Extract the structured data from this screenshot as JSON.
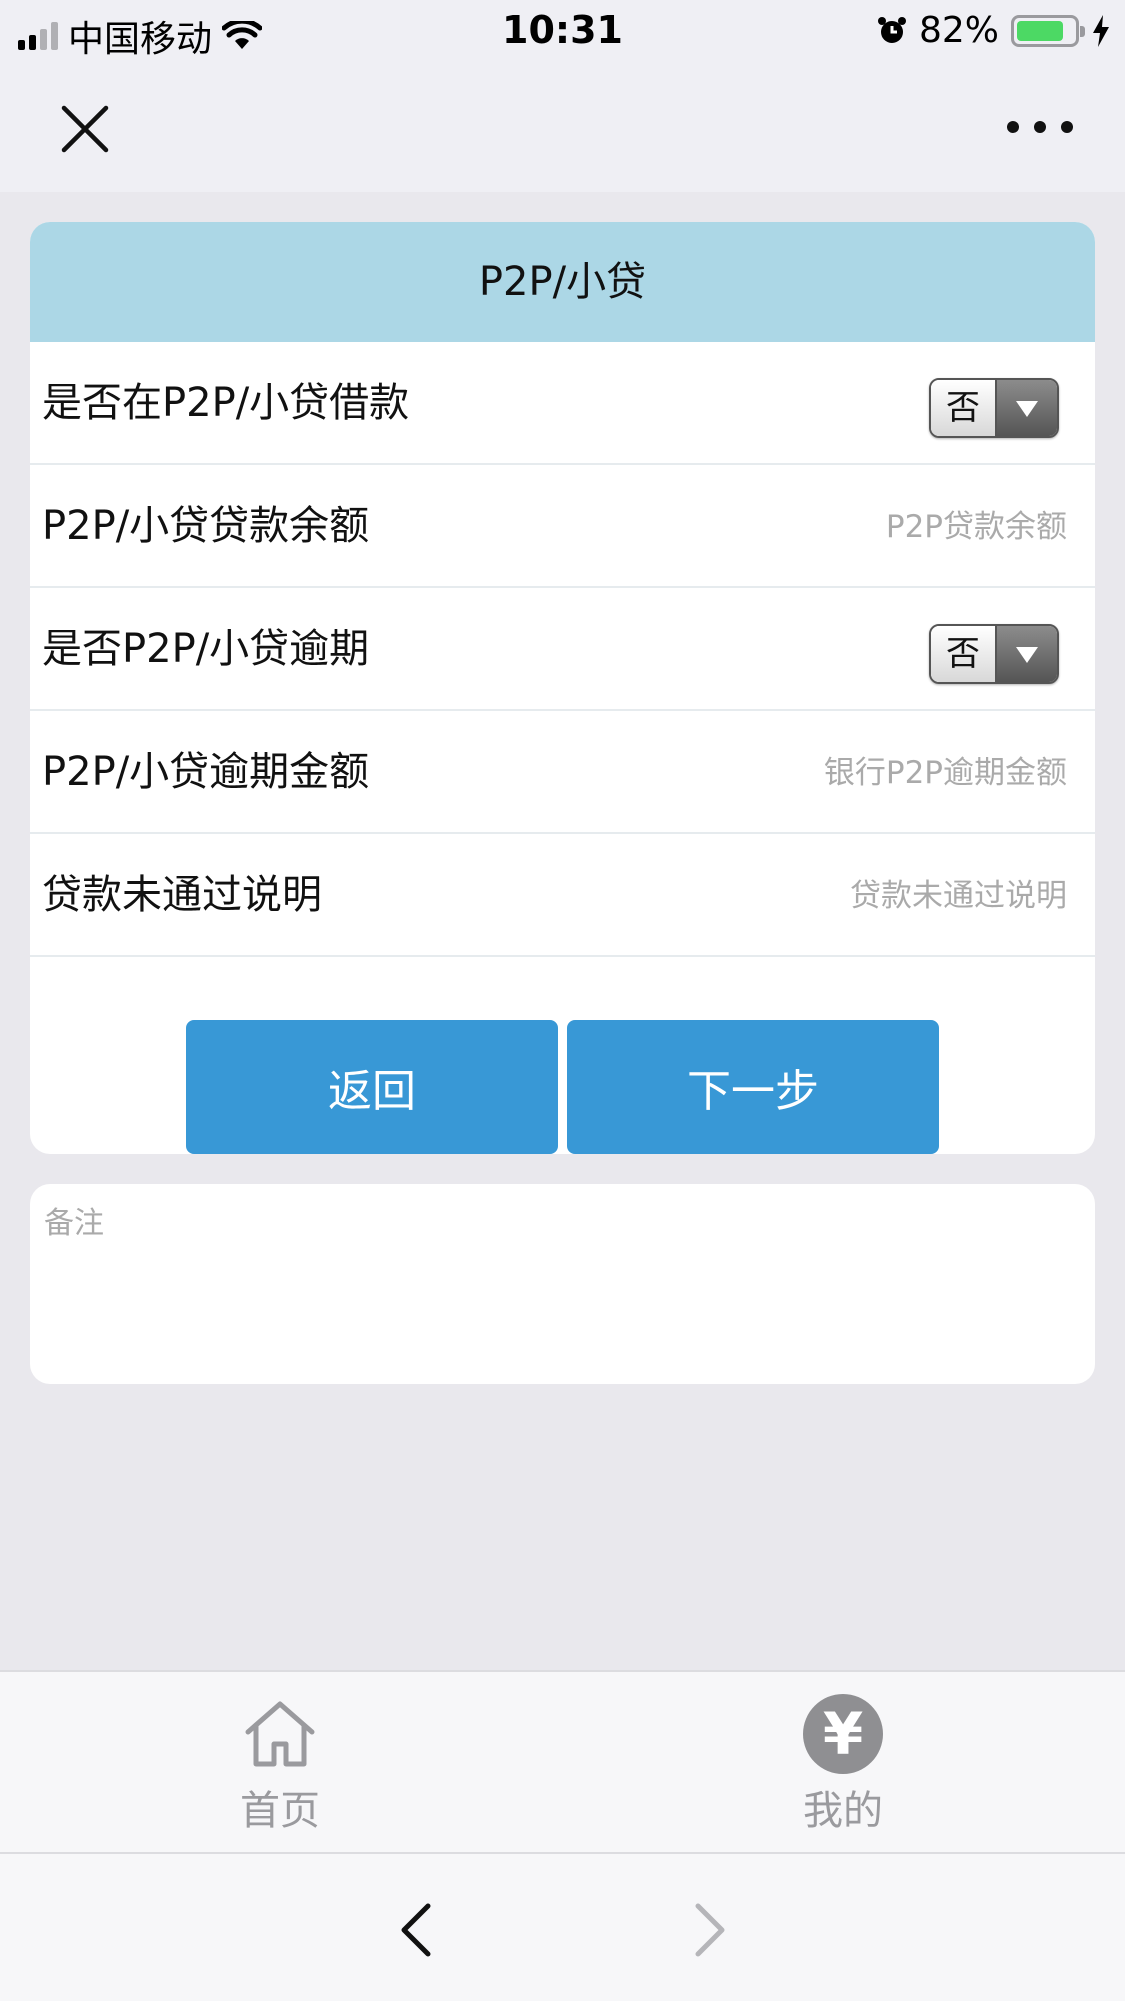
{
  "status_bar": {
    "carrier": "中国移动",
    "time": "10:31",
    "battery_percent": "82%",
    "battery_level": 0.82,
    "icons": [
      "signal-icon",
      "wifi-icon",
      "alarm-icon",
      "battery-icon",
      "charging-icon"
    ]
  },
  "nav": {
    "close_icon": "close-icon",
    "more_icon": "more-icon"
  },
  "card": {
    "title": "P2P/小贷",
    "rows": [
      {
        "label": "是否在P2P/小贷借款",
        "type": "select",
        "value": "否"
      },
      {
        "label": "P2P/小贷贷款余额",
        "type": "input",
        "placeholder": "P2P贷款余额"
      },
      {
        "label": "是否P2P/小贷逾期",
        "type": "select",
        "value": "否"
      },
      {
        "label": "P2P/小贷逾期金额",
        "type": "input",
        "placeholder": "银行P2P逾期金额"
      },
      {
        "label": "贷款未通过说明",
        "type": "input",
        "placeholder": "贷款未通过说明"
      }
    ],
    "back_label": "返回",
    "next_label": "下一步",
    "button_color": "#3898d6",
    "header_color": "#acd7e6"
  },
  "remark": {
    "placeholder": "备注"
  },
  "tab_bar": {
    "home_label": "首页",
    "mine_label": "我的",
    "mine_icon_glyph": "¥"
  },
  "browser_bar": {
    "back_icon": "chevron-left-icon",
    "forward_icon": "chevron-right-icon"
  }
}
